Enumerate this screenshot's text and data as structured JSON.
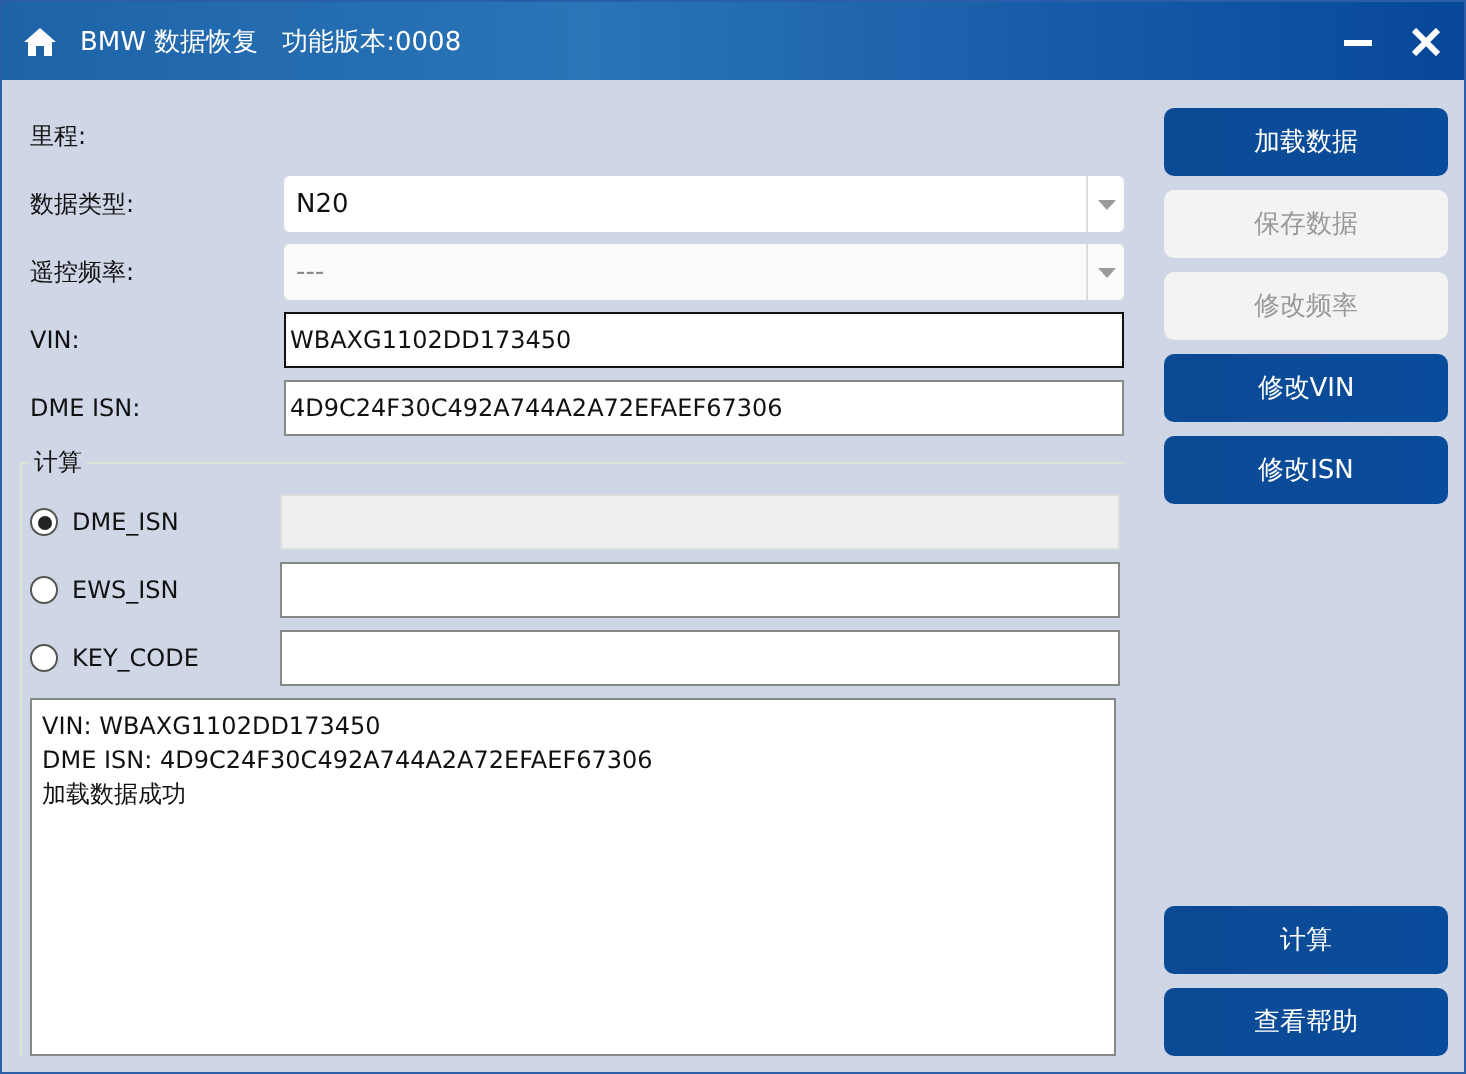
{
  "window": {
    "title": "BMW 数据恢复",
    "version": "功能版本:0008"
  },
  "mileage_label": "里程:",
  "fields": [
    {
      "kind": "select",
      "label": "数据类型:",
      "value": "N20",
      "disabled": false
    },
    {
      "kind": "select",
      "label": "遥控频率:",
      "value": "---",
      "disabled": true
    },
    {
      "kind": "text",
      "label": "VIN:",
      "value": "WBAXG1102DD173450",
      "focused": true
    },
    {
      "kind": "text",
      "label": "DME ISN:",
      "value": "4D9C24F30C492A744A2A72EFAEF67306",
      "focused": false
    }
  ],
  "calc": {
    "title": "计算",
    "options": [
      {
        "label": "DME_ISN",
        "selected": true,
        "field_disabled": true
      },
      {
        "label": "EWS_ISN",
        "selected": false,
        "field_disabled": false
      },
      {
        "label": "KEY_CODE",
        "selected": false,
        "field_disabled": false
      }
    ]
  },
  "log": [
    "VIN: WBAXG1102DD173450",
    "DME ISN: 4D9C24F30C492A744A2A72EFAEF67306",
    "加载数据成功"
  ],
  "buttons_top": [
    {
      "label": "加载数据",
      "disabled": false
    },
    {
      "label": "保存数据",
      "disabled": true
    },
    {
      "label": "修改频率",
      "disabled": true
    },
    {
      "label": "修改VIN",
      "disabled": false
    },
    {
      "label": "修改ISN",
      "disabled": false
    }
  ],
  "buttons_bottom": [
    {
      "label": "计算",
      "disabled": false
    },
    {
      "label": "查看帮助",
      "disabled": false
    }
  ]
}
